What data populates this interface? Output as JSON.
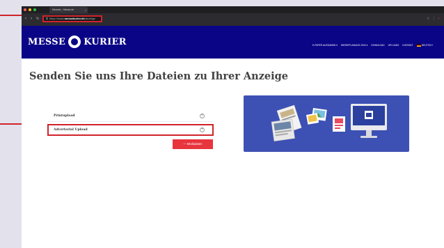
{
  "browser": {
    "tab_title": "Hinweis – Messe.de",
    "tab_close": "×",
    "url_prefix": "https://www.",
    "url_domain": "messekurier.de",
    "url_path": "/anzeige"
  },
  "site": {
    "logo_left": "MESSE",
    "logo_right": "KURIER",
    "menu": [
      {
        "label": "E-PAPER AUSGABEN",
        "caret": "▾"
      },
      {
        "label": "MESSEPLANUNG 2024",
        "caret": "▾"
      },
      {
        "label": "DOWNLOAD"
      },
      {
        "label": "UPLOADS"
      },
      {
        "label": "KONTAKT"
      },
      {
        "label": "DEUTSCH"
      }
    ]
  },
  "page": {
    "title": "Senden Sie uns Ihre Dateien zu Ihrer Anzeige",
    "accordion": [
      {
        "label": "Printupload"
      },
      {
        "label": "Advertorial Upload"
      }
    ],
    "button_label": "— Mediadaten"
  },
  "colors": {
    "header_bg": "#0a0486",
    "annotation_red": "#d1232a",
    "button_red": "#e8343d",
    "illustration_bg": "#3d51b4"
  }
}
